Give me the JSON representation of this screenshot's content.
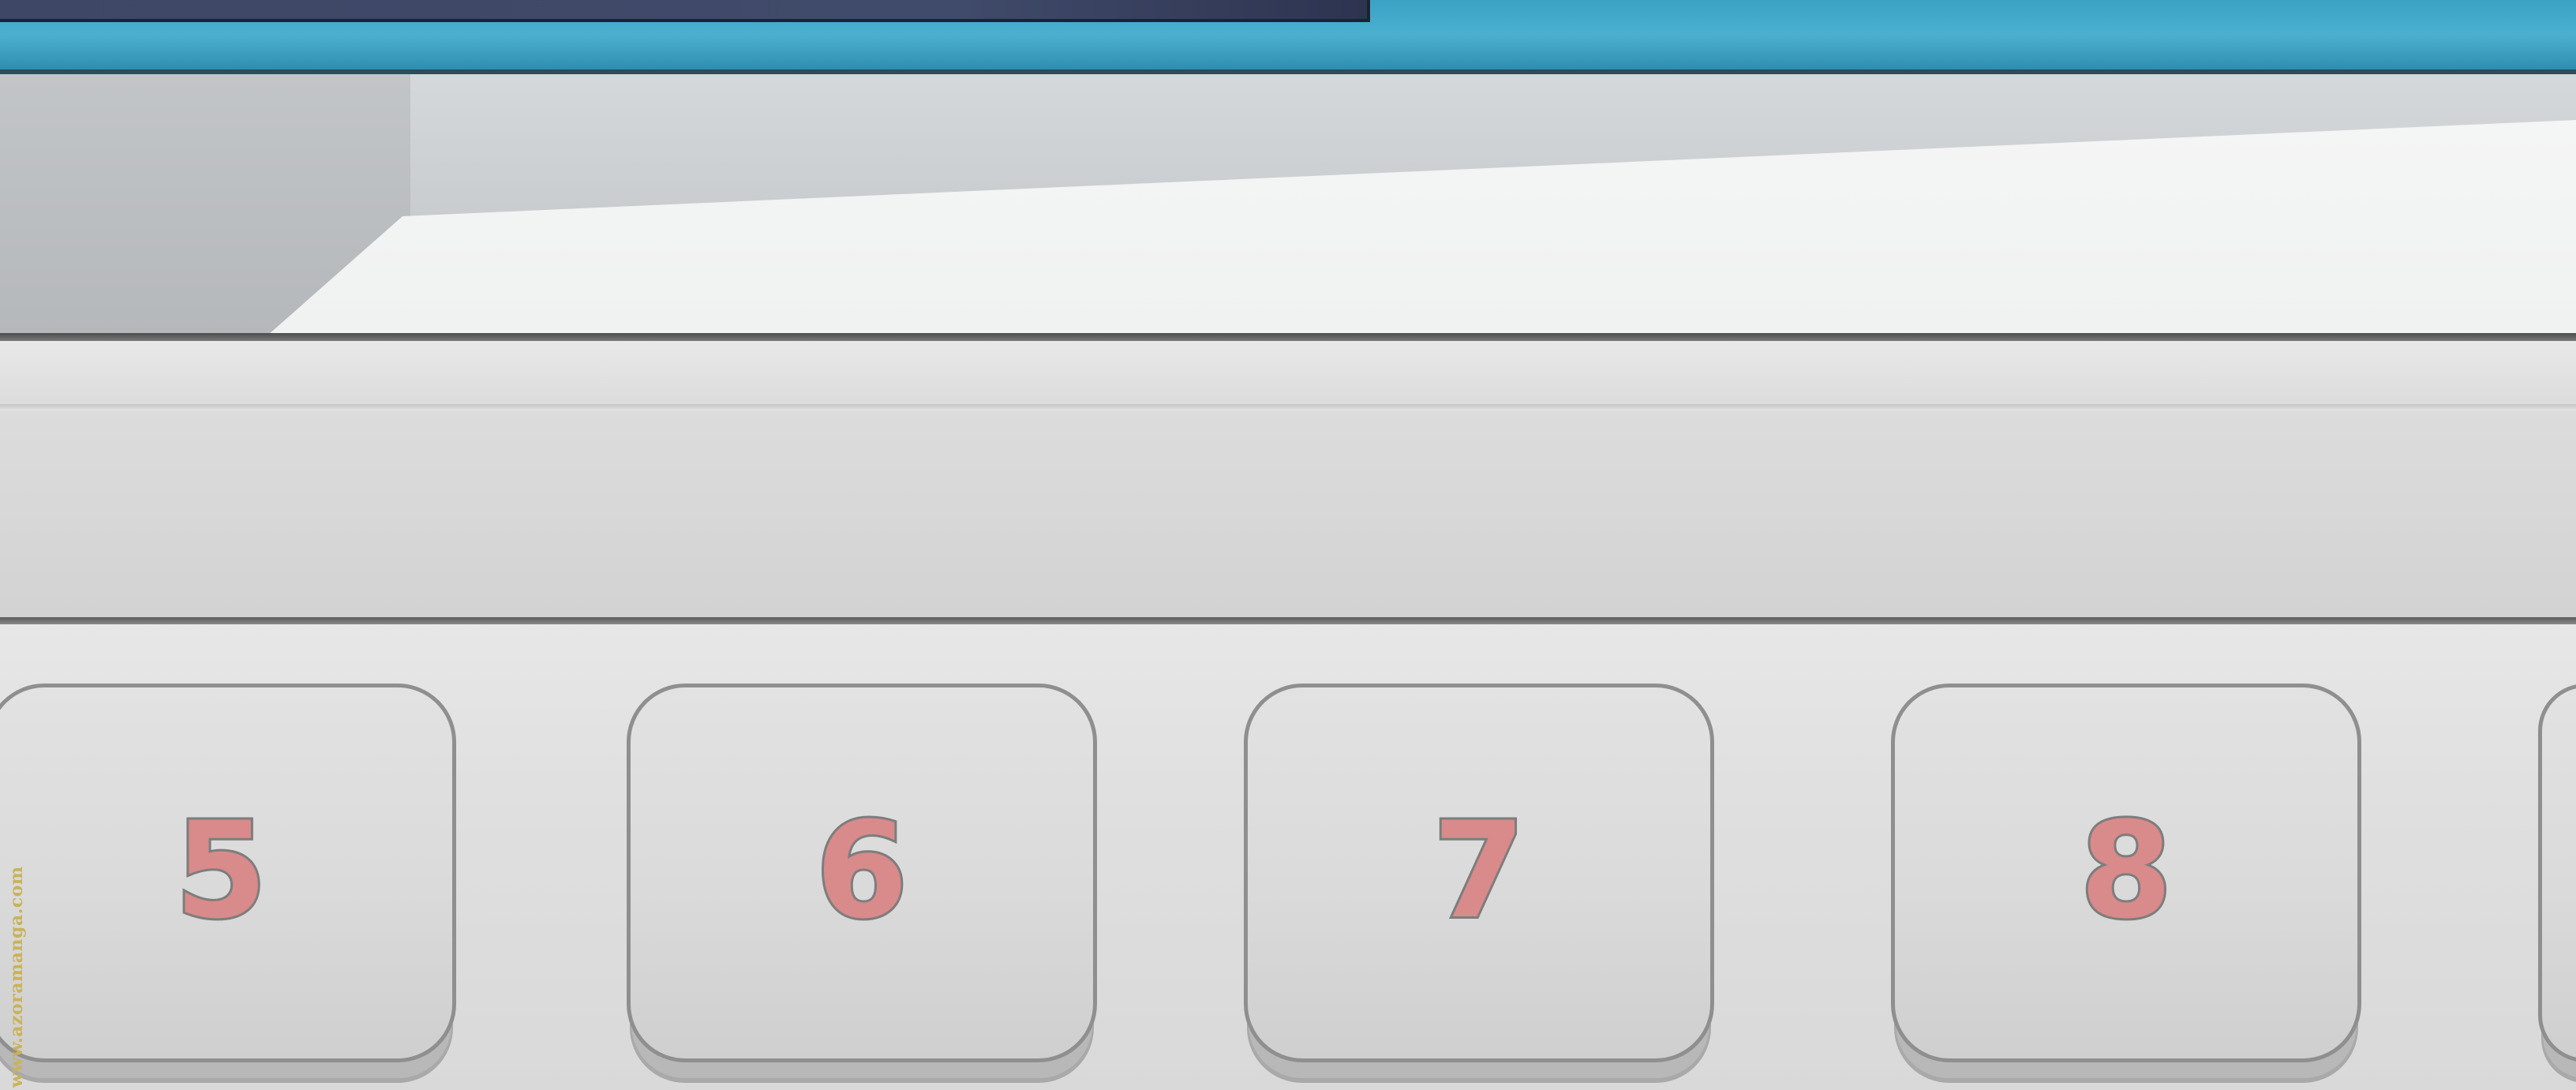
{
  "keypad": {
    "keys": [
      {
        "label": "5"
      },
      {
        "label": "6"
      },
      {
        "label": "7"
      },
      {
        "label": "8"
      }
    ]
  },
  "watermark": {
    "text": "www.azoramanga.com"
  },
  "colors": {
    "screen_blue": "#3ba2c4",
    "screen_panel": "#3f4766",
    "bezel_gray": "#d4d8da",
    "key_face": "#dadada",
    "key_border": "#8f8f8f",
    "digit_fill": "#d98a8a",
    "digit_outline": "#7d7d7d"
  }
}
